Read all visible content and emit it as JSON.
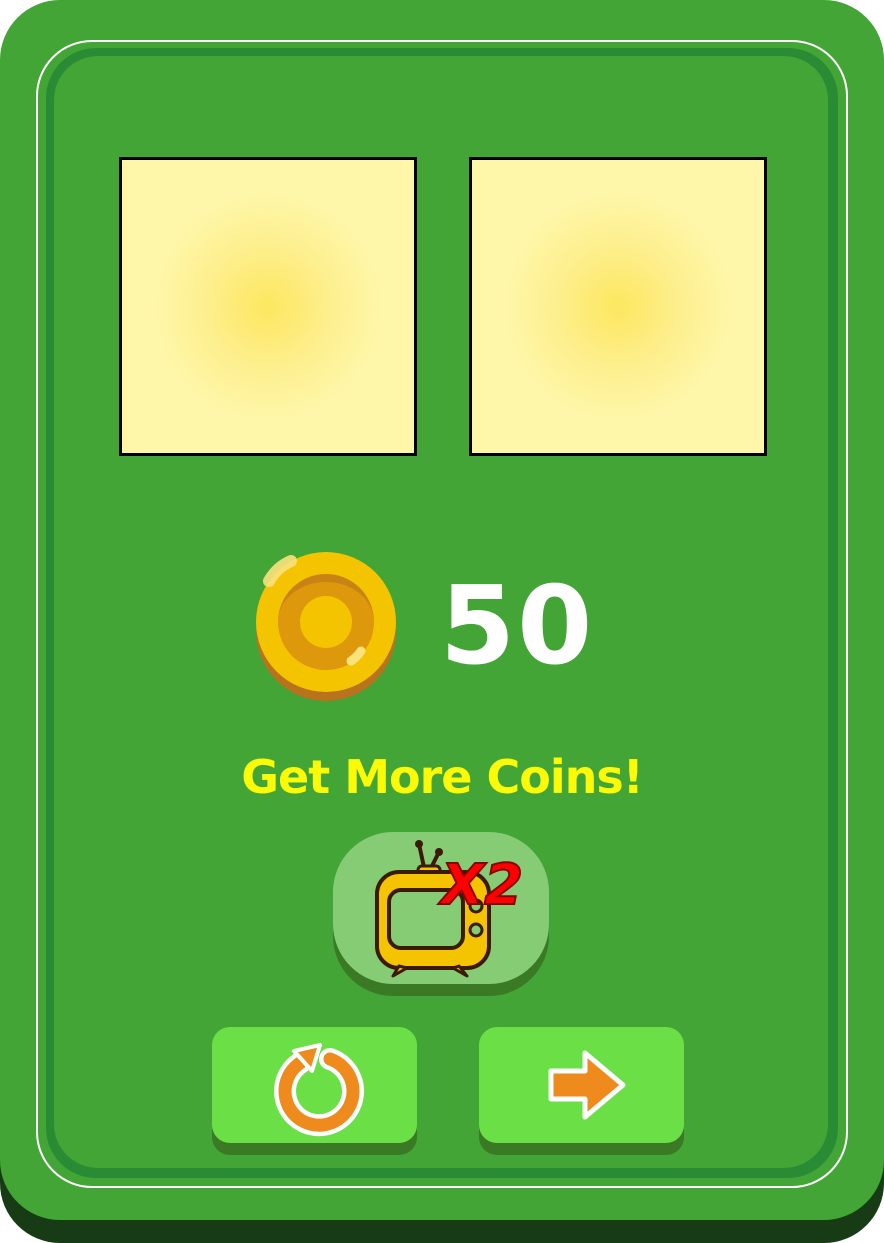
{
  "coins": {
    "count": "50",
    "icon": "coin-icon"
  },
  "promo": {
    "text": "Get More Coins!"
  },
  "ad_button": {
    "icon": "tv-icon",
    "multiplier_label": "X2"
  },
  "buttons": {
    "retry_icon": "retry-icon",
    "next_icon": "arrow-right-icon"
  },
  "colors": {
    "panel": "#42a535",
    "panel_dark": "#2a8b35",
    "slot_fill": "#fef7a9",
    "slot_center": "#fde75f",
    "promo_text": "#fbfb07",
    "button_face": "#6ae046",
    "ad_button_face": "#85cc75",
    "icon_orange": "#ef8a1c",
    "multiplier_red": "#ff0000",
    "coin_gold": "#f5c400"
  }
}
